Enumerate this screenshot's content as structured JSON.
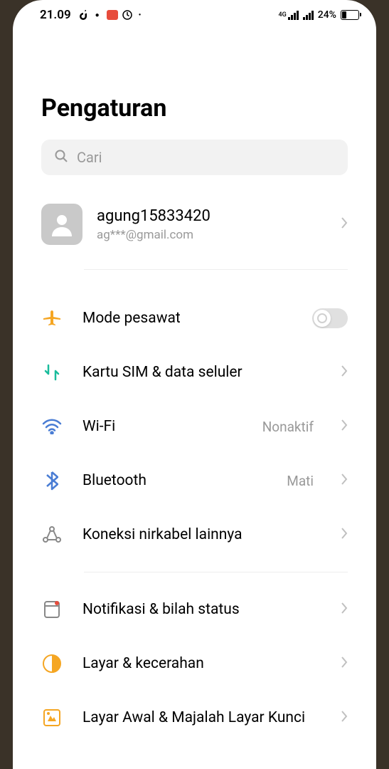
{
  "status_bar": {
    "time": "21.09",
    "battery_percent": "24%",
    "signal_4g_label": "4G"
  },
  "page": {
    "title": "Pengaturan"
  },
  "search": {
    "placeholder": "Cari"
  },
  "account": {
    "name": "agung15833420",
    "email": "ag***@gmail.com"
  },
  "settings": {
    "airplane": {
      "label": "Mode pesawat"
    },
    "sim": {
      "label": "Kartu SIM & data seluler"
    },
    "wifi": {
      "label": "Wi-Fi",
      "value": "Nonaktif"
    },
    "bluetooth": {
      "label": "Bluetooth",
      "value": "Mati"
    },
    "wireless": {
      "label": "Koneksi nirkabel lainnya"
    },
    "notifications": {
      "label": "Notifikasi & bilah status"
    },
    "display": {
      "label": "Layar & kecerahan"
    },
    "lockscreen": {
      "label": "Layar Awal & Majalah Layar Kunci"
    }
  }
}
